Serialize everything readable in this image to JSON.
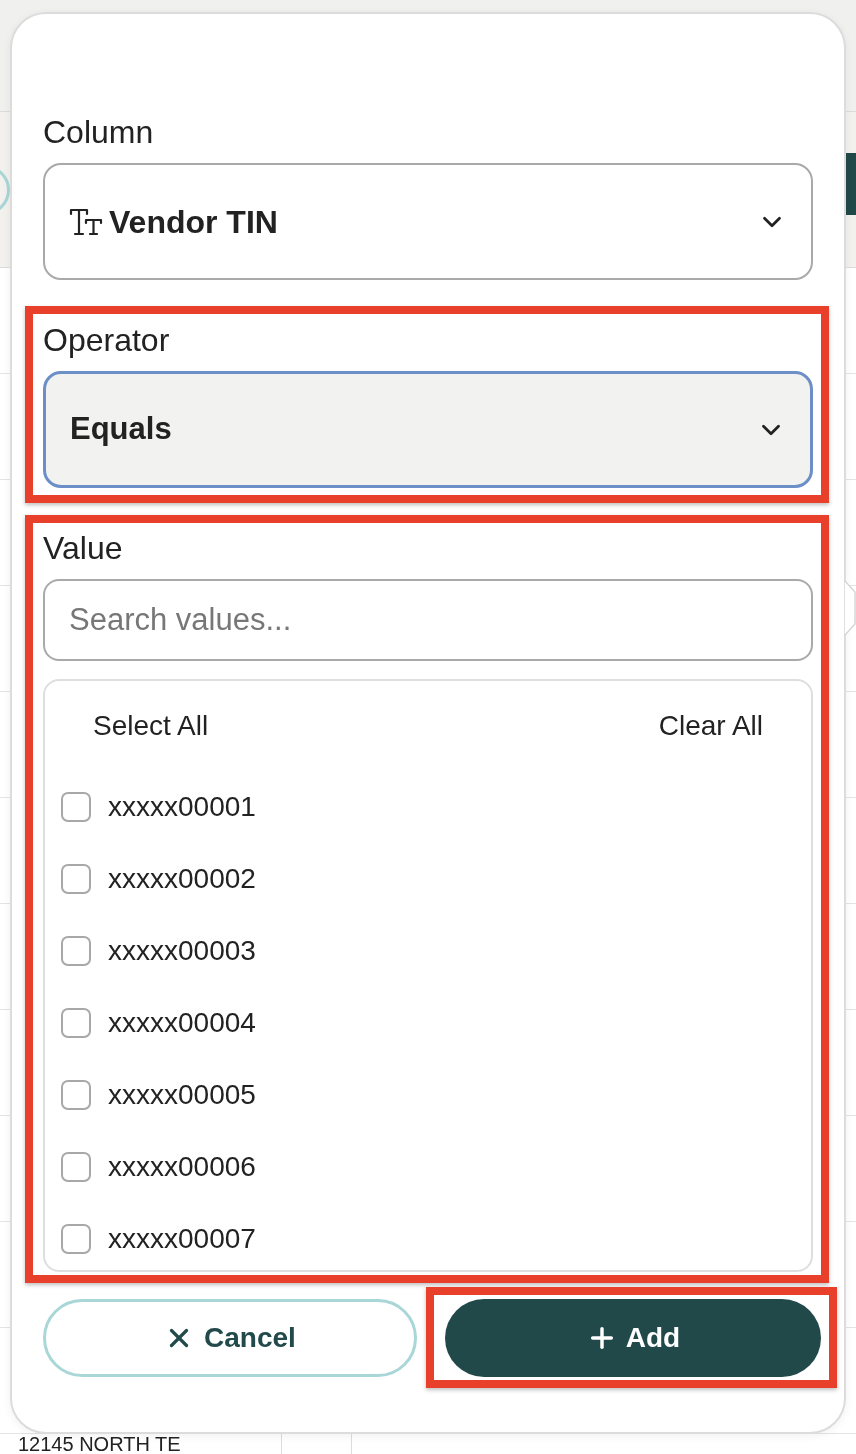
{
  "background": {
    "text": "12145 NORTH TE"
  },
  "filter_popover": {
    "column": {
      "label": "Column",
      "value": "Vendor TIN",
      "highlighted": false
    },
    "operator": {
      "label": "Operator",
      "value": "Equals",
      "focused": true,
      "highlighted": true
    },
    "value": {
      "label": "Value",
      "highlighted": true,
      "search": {
        "placeholder": "Search values..."
      },
      "select_all": "Select All",
      "clear_all": "Clear All",
      "options": [
        {
          "label": "xxxxx00001",
          "checked": false
        },
        {
          "label": "xxxxx00002",
          "checked": false
        },
        {
          "label": "xxxxx00003",
          "checked": false
        },
        {
          "label": "xxxxx00004",
          "checked": false
        },
        {
          "label": "xxxxx00005",
          "checked": false
        },
        {
          "label": "xxxxx00006",
          "checked": false
        },
        {
          "label": "xxxxx00007",
          "checked": false
        }
      ]
    },
    "buttons": [
      {
        "kind": "cancel",
        "label": "Cancel",
        "highlighted": false
      },
      {
        "kind": "add",
        "label": "Add",
        "highlighted": true
      }
    ]
  }
}
